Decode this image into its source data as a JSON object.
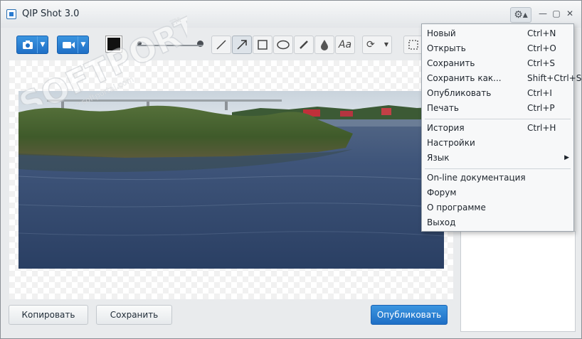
{
  "window": {
    "title": "QIP Shot 3.0"
  },
  "window_controls": {
    "minimize": "—",
    "maximize": "▢",
    "close": "✕"
  },
  "settings_button": {
    "glyph": "⚙▴"
  },
  "toolbar": {
    "screenshot_icon": "camera-icon",
    "video_icon": "video-camera-icon",
    "color": "#111111",
    "tools": [
      "line",
      "arrow",
      "rectangle",
      "ellipse",
      "pencil",
      "blur",
      "text"
    ],
    "text_tool_label": "Aa"
  },
  "menu": {
    "items": [
      {
        "label": "Новый",
        "shortcut": "Ctrl+N"
      },
      {
        "label": "Открыть",
        "shortcut": "Ctrl+O"
      },
      {
        "label": "Сохранить",
        "shortcut": "Ctrl+S"
      },
      {
        "label": "Сохранить как...",
        "shortcut": "Shift+Ctrl+S"
      },
      {
        "label": "Опубликовать",
        "shortcut": "Ctrl+I"
      },
      {
        "label": "Печать",
        "shortcut": "Ctrl+P"
      },
      {
        "label": "История",
        "shortcut": "Ctrl+H"
      },
      {
        "label": "Настройки",
        "shortcut": ""
      },
      {
        "label": "Язык",
        "shortcut": ""
      },
      {
        "label": "On-line документация",
        "shortcut": ""
      },
      {
        "label": "Форум",
        "shortcut": ""
      },
      {
        "label": "О программе",
        "shortcut": ""
      },
      {
        "label": "Выход",
        "shortcut": ""
      }
    ]
  },
  "bottom": {
    "copy_label": "Копировать",
    "save_label": "Сохранить",
    "publish_label": "Опубликовать"
  },
  "watermark": {
    "brand": "SOFTPORTAL",
    "url": "www.softportal.com",
    "tm": "TM"
  },
  "colors": {
    "accent": "#1f6fc6"
  }
}
